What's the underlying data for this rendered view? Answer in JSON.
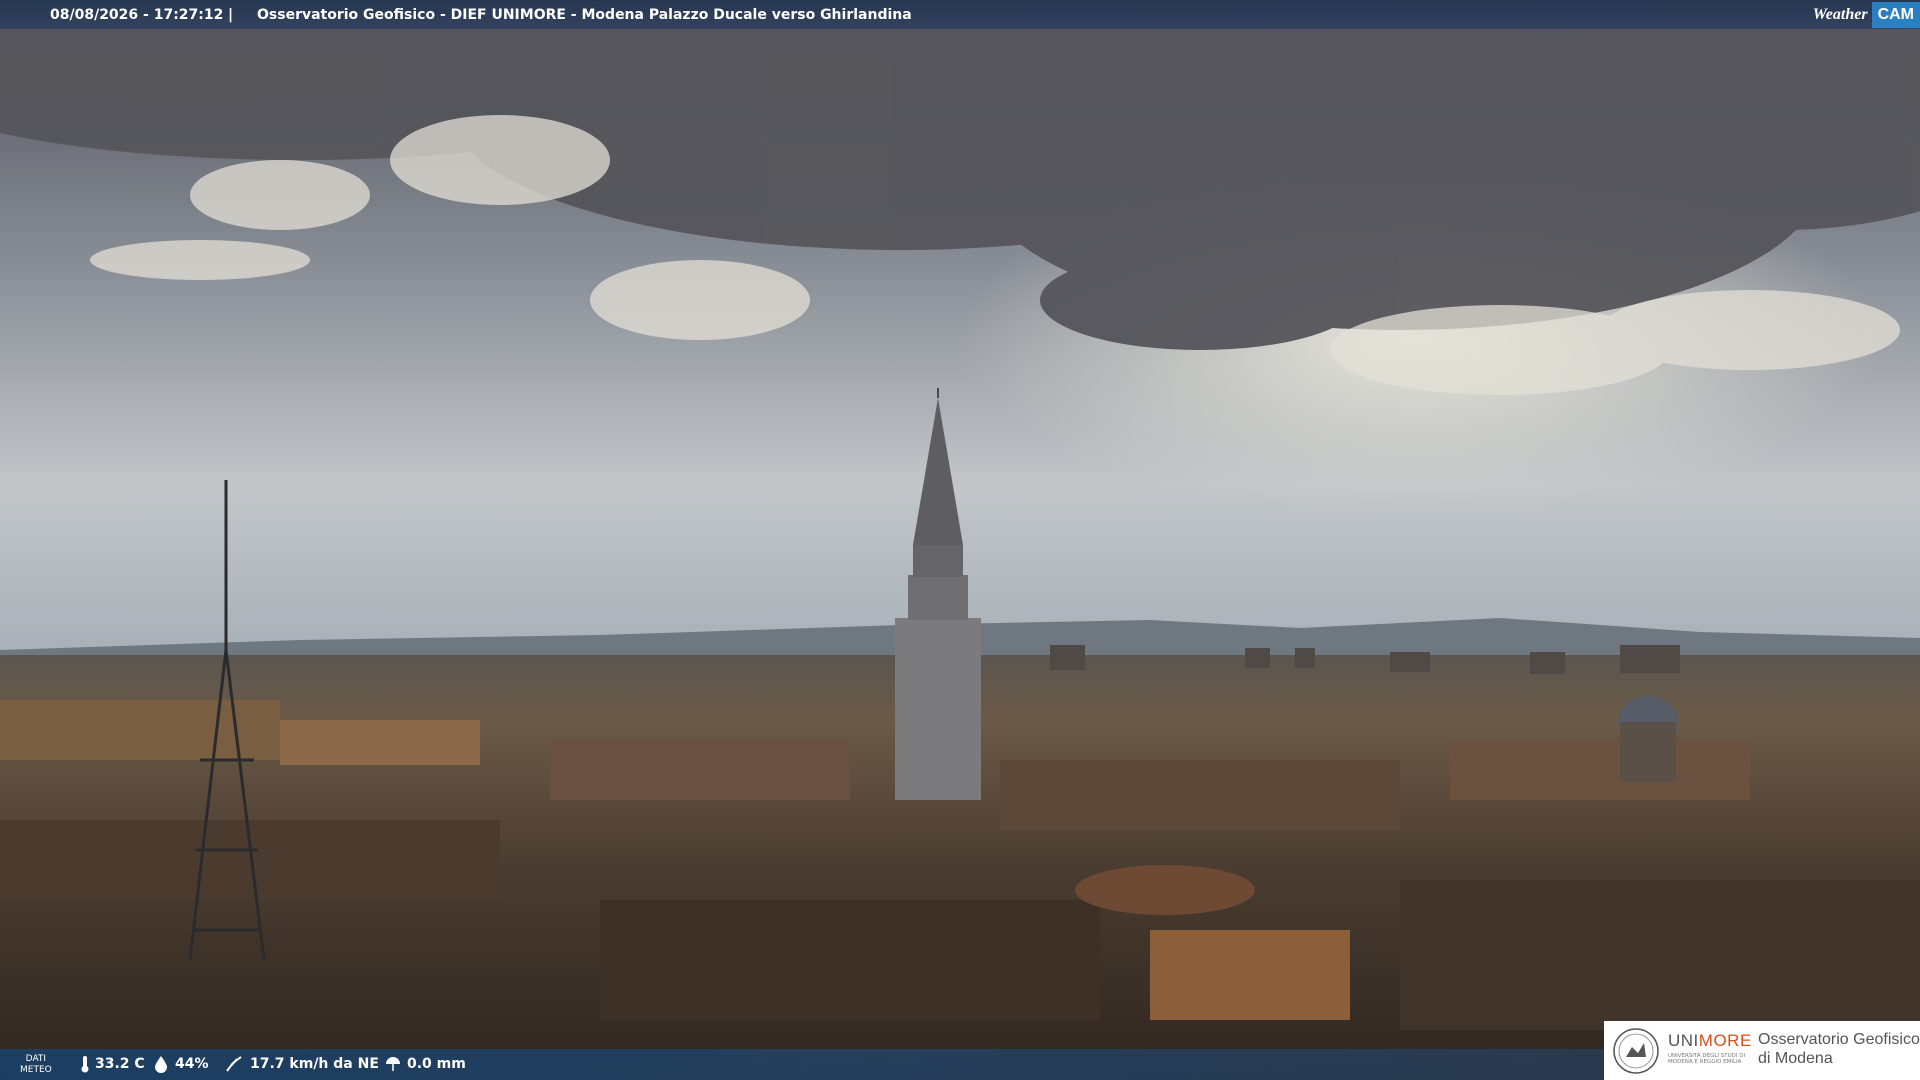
{
  "overlay_top": {
    "timestamp": "08/08/2026 - 17:27:12",
    "separator": "|",
    "title": "Osservatorio Geofisico - DIEF UNIMORE - Modena Palazzo Ducale verso Ghirlandina",
    "logo_left": "Weather",
    "logo_right": "CAM"
  },
  "overlay_bottom": {
    "dati_line1": "DATI",
    "dati_line2": "METEO",
    "temperature": "33.2 C",
    "humidity": "44%",
    "wind": "17.7 km/h da NE",
    "rain": "0.0 mm",
    "icons": [
      "thermometer-icon",
      "humidity-drop-icon",
      "wind-icon",
      "rain-icon"
    ]
  },
  "branding": {
    "uni_prefix": "UNI",
    "uni_suffix": "MORE",
    "uni_subtitle": "UNIVERSITÀ DEGLI STUDI DI MODENA E REGGIO EMILIA",
    "observatory_line1": "Osservatorio Geofisico",
    "observatory_line2": "di Modena",
    "accent": "#d94f1c"
  }
}
